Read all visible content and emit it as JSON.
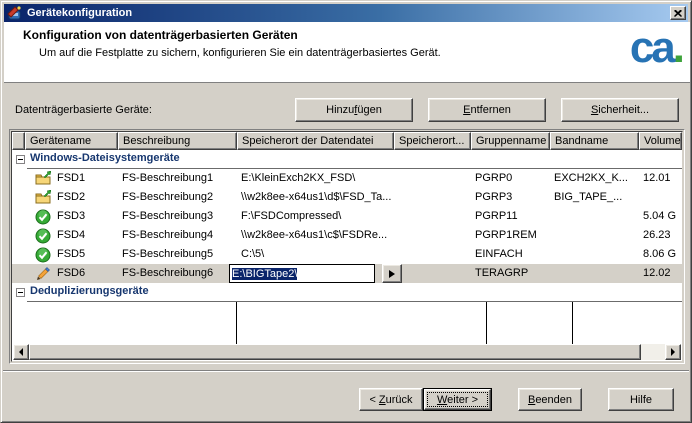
{
  "window": {
    "title": "Gerätekonfiguration"
  },
  "header": {
    "title": "Konfiguration von datenträgerbasierten Geräten",
    "subtitle": "Um auf die Festplatte zu sichern, konfigurieren Sie ein datenträgerbasiertes Gerät.",
    "logo_text": "ca",
    "logo_dot": "."
  },
  "toolbar": {
    "label": "Datenträgerbasierte Geräte:",
    "add": {
      "pre": "Hinzu",
      "key": "f",
      "post": "ügen"
    },
    "remove": {
      "pre": "",
      "key": "E",
      "post": "ntfernen"
    },
    "security": {
      "pre": "",
      "key": "S",
      "post": "icherheit..."
    }
  },
  "grid": {
    "columns": [
      "",
      "Gerätename",
      "Beschreibung",
      "Speicherort der Datendatei",
      "Speicherort...",
      "Gruppenname",
      "Bandname",
      "Volume"
    ],
    "groups": [
      {
        "label": "Windows-Dateisystemgeräte"
      },
      {
        "label": "Deduplizierungsgeräte"
      }
    ],
    "rows": [
      {
        "icon": "folder-check-icon",
        "name": "FSD1",
        "desc": "FS-Beschreibung1",
        "path": "E:\\KleinExch2KX_FSD\\",
        "loc2": "",
        "group": "PGRP0",
        "band": "EXCH2KX_K...",
        "vol": "12.01"
      },
      {
        "icon": "folder-check-icon",
        "name": "FSD2",
        "desc": "FS-Beschreibung2",
        "path": "\\\\w2k8ee-x64us1\\d$\\FSD_Ta...",
        "loc2": "",
        "group": "PGRP3",
        "band": "BIG_TAPE_...",
        "vol": ""
      },
      {
        "icon": "green-check-icon",
        "name": "FSD3",
        "desc": "FS-Beschreibung3",
        "path": "F:\\FSDCompressed\\",
        "loc2": "",
        "group": "PGRP11",
        "band": "",
        "vol": "5.04 G"
      },
      {
        "icon": "green-check-icon",
        "name": "FSD4",
        "desc": "FS-Beschreibung4",
        "path": "\\\\w2k8ee-x64us1\\c$\\FSDRe...",
        "loc2": "",
        "group": "PGRP1REM",
        "band": "",
        "vol": "26.23"
      },
      {
        "icon": "green-check-icon",
        "name": "FSD5",
        "desc": "FS-Beschreibung5",
        "path": "C:\\5\\",
        "loc2": "",
        "group": "EINFACH",
        "band": "",
        "vol": "8.06 G"
      },
      {
        "icon": "pencil-icon",
        "name": "FSD6",
        "desc": "FS-Beschreibung6",
        "path": "",
        "loc2": "",
        "group": "TERAGRP",
        "band": "",
        "vol": "12.02"
      }
    ],
    "edit": {
      "value": "E:\\BIGTape2\\"
    }
  },
  "footer": {
    "back": {
      "pre": "< ",
      "key": "Z",
      "post": "urück"
    },
    "next": {
      "pre": "",
      "key": "W",
      "post": "eiter >"
    },
    "finish": {
      "pre": "",
      "key": "B",
      "post": "eenden"
    },
    "help_label": "Hilfe"
  },
  "icons": {
    "window-icon": "device-config",
    "close-icon": "✕",
    "folder-check-icon": "folder with green arrow",
    "green-check-icon": "green circle white check",
    "pencil-icon": "pencil (editing)",
    "collapse-icon": "⊟",
    "scroll-left-icon": "◄",
    "scroll-right-icon": "►",
    "dropdown-right-icon": "►"
  },
  "colors": {
    "titlebar_gradient_start": "#0A246A",
    "titlebar_gradient_end": "#A6CAF0",
    "dialog_bg": "#D4D0C8",
    "group_text": "#17376F",
    "selection_bg": "#0A246A",
    "logo_blue": "#2773B4",
    "logo_green": "#3FA33C"
  }
}
